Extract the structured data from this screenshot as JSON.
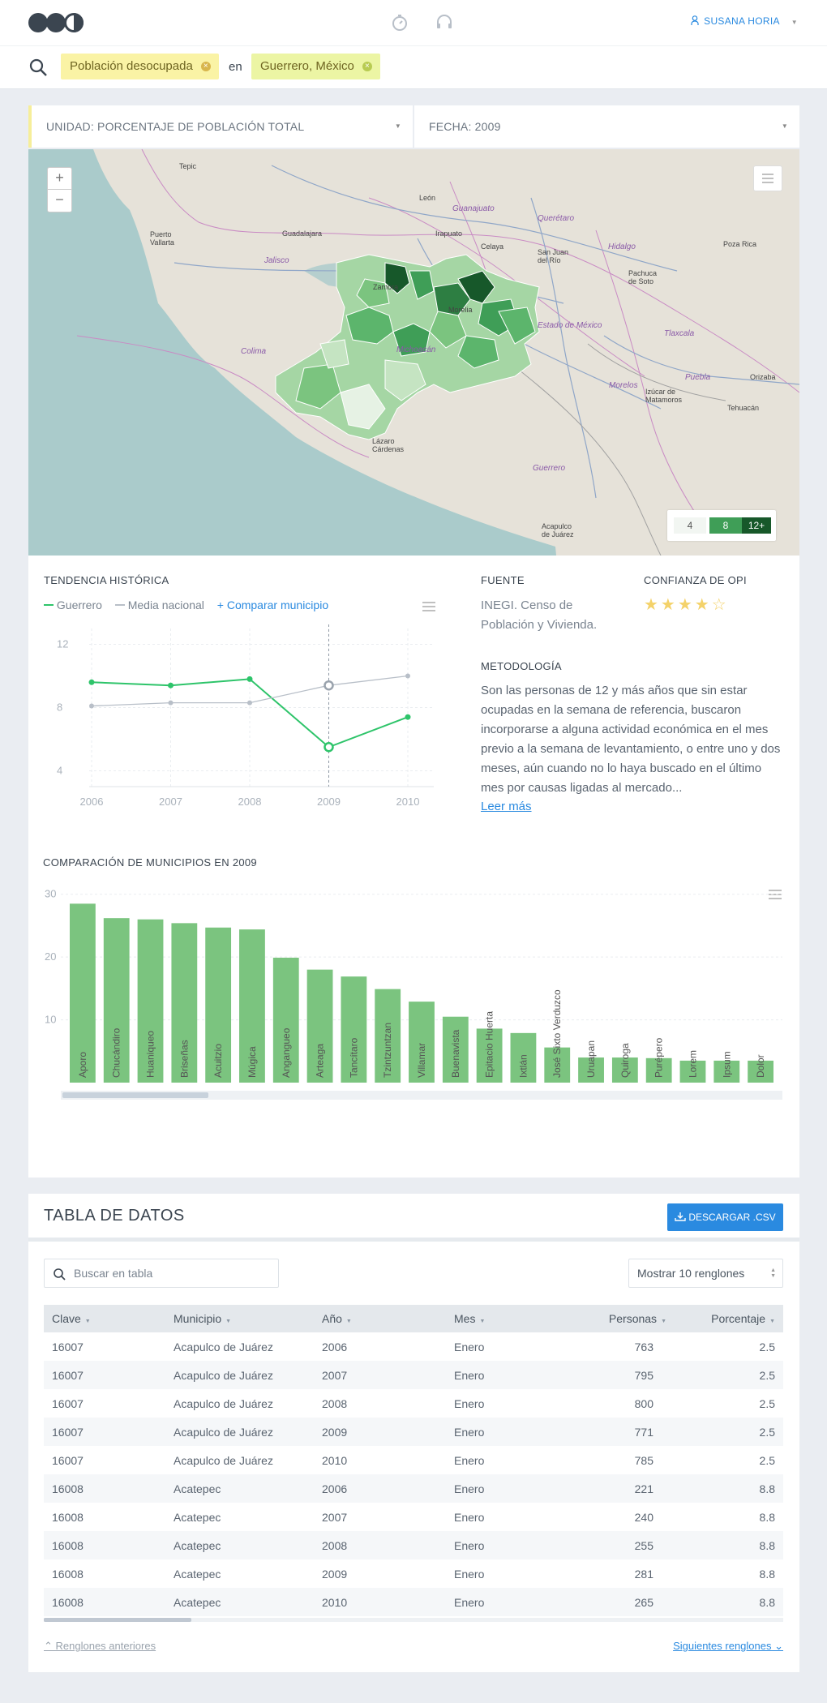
{
  "header": {
    "user_name": "SUSANA HORIA"
  },
  "search": {
    "chip1": "Población desocupada",
    "connector": "en",
    "chip2": "Guerrero, México"
  },
  "filters": {
    "unit": "UNIDAD: PORCENTAJE DE POBLACIÓN TOTAL",
    "date": "FECHA: 2009"
  },
  "map": {
    "zoom_in": "+",
    "zoom_out": "−",
    "cities": [
      "Tepic",
      "León",
      "Guanajuato",
      "Querétaro",
      "Puerto Vallarta",
      "Guadalajara",
      "Irapuato",
      "Celaya",
      "San Juan del Río",
      "Hidalgo",
      "Pachuca de Soto",
      "Poza Rica",
      "Jalisco",
      "Zamora",
      "Morelia",
      "Estado de México",
      "Tlaxcala",
      "Colima",
      "Michoacán",
      "Morelos",
      "Puebla",
      "Orizaba",
      "Izúcar de Matamoros",
      "Tehuacán",
      "Lázaro Cárdenas",
      "Guerrero",
      "Acapulco de Juárez"
    ],
    "legend": [
      "4",
      "8",
      "12+"
    ],
    "legend_colors": [
      "#f2f6f2",
      "#3f9e57",
      "#17582a"
    ]
  },
  "trend": {
    "title": "TENDENCIA HISTÓRICA",
    "series1": "Guerrero",
    "series2": "Media nacional",
    "compare": "+ Comparar municipio",
    "colors": {
      "s1": "#2ec46a",
      "s2": "#b8bfc8"
    }
  },
  "source": {
    "title": "FUENTE",
    "text": "INEGI. Censo de Población y Vivienda."
  },
  "confidence": {
    "title": "CONFIANZA DE OPI",
    "stars": "★★★★☆",
    "rating": 4,
    "max": 5
  },
  "method": {
    "title": "METODOLOGÍA",
    "text": "Son las personas de 12 y más años que sin estar ocupadas en la semana de referencia, buscaron incorporarse a alguna actividad económica en el mes previo a la semana de levantamiento, o entre uno y dos meses, aún cuando no lo haya buscado en el último mes por causas ligadas al mercado...",
    "more": "Leer más"
  },
  "compare": {
    "title": "COMPARACIÓN DE MUNICIPIOS EN 2009",
    "bar_color": "#7bc47f"
  },
  "chart_data": [
    {
      "type": "line",
      "title": "TENDENCIA HISTÓRICA",
      "x": [
        "2006",
        "2007",
        "2008",
        "2009",
        "2010"
      ],
      "series": [
        {
          "name": "Guerrero",
          "values": [
            9.6,
            9.4,
            9.8,
            5.5,
            7.4
          ]
        },
        {
          "name": "Media nacional",
          "values": [
            8.1,
            8.3,
            8.3,
            9.4,
            10.0
          ]
        }
      ],
      "ylim": [
        3,
        13
      ],
      "yticks": [
        4,
        8,
        12
      ],
      "highlight": "2009",
      "grid": true
    },
    {
      "type": "bar",
      "title": "COMPARACIÓN DE MUNICIPIOS EN 2009",
      "categories": [
        "Aporo",
        "Chucándiro",
        "Huaniqueo",
        "Briseñas",
        "Acuitzio",
        "Múgica",
        "Angangueo",
        "Arteaga",
        "Tancítaro",
        "Tzintzuntzan",
        "Villamar",
        "Buenavista",
        "Epitacio Huerta",
        "Ixtlán",
        "José Sixto Verduzco",
        "Uruapan",
        "Quiroga",
        "Purépero",
        "Lorem",
        "Ipsum",
        "Dolor"
      ],
      "values": [
        28.5,
        26.2,
        26.0,
        25.4,
        24.7,
        24.4,
        19.9,
        18.0,
        16.9,
        14.9,
        12.9,
        10.5,
        8.6,
        7.9,
        5.6,
        4.0,
        4.0,
        3.9,
        3.5,
        3.5,
        3.5
      ],
      "ylim": [
        0,
        31
      ],
      "yticks": [
        10,
        20,
        30
      ],
      "grid": true
    }
  ],
  "table": {
    "title": "TABLA DE DATOS",
    "download": "DESCARGAR .CSV",
    "search_placeholder": "Buscar en tabla",
    "rows_select": "Mostrar 10 renglones",
    "headers": [
      "Clave",
      "Municipio",
      "Año",
      "Mes",
      "Personas",
      "Porcentaje"
    ],
    "rows": [
      [
        "16007",
        "Acapulco de Juárez",
        "2006",
        "Enero",
        "763",
        "2.5"
      ],
      [
        "16007",
        "Acapulco de Juárez",
        "2007",
        "Enero",
        "795",
        "2.5"
      ],
      [
        "16007",
        "Acapulco de Juárez",
        "2008",
        "Enero",
        "800",
        "2.5"
      ],
      [
        "16007",
        "Acapulco de Juárez",
        "2009",
        "Enero",
        "771",
        "2.5"
      ],
      [
        "16007",
        "Acapulco de Juárez",
        "2010",
        "Enero",
        "785",
        "2.5"
      ],
      [
        "16008",
        "Acatepec",
        "2006",
        "Enero",
        "221",
        "8.8"
      ],
      [
        "16008",
        "Acatepec",
        "2007",
        "Enero",
        "240",
        "8.8"
      ],
      [
        "16008",
        "Acatepec",
        "2008",
        "Enero",
        "255",
        "8.8"
      ],
      [
        "16008",
        "Acatepec",
        "2009",
        "Enero",
        "281",
        "8.8"
      ],
      [
        "16008",
        "Acatepec",
        "2010",
        "Enero",
        "265",
        "8.8"
      ]
    ],
    "prev": "Renglones anteriores",
    "next": "Siguientes renglones"
  }
}
